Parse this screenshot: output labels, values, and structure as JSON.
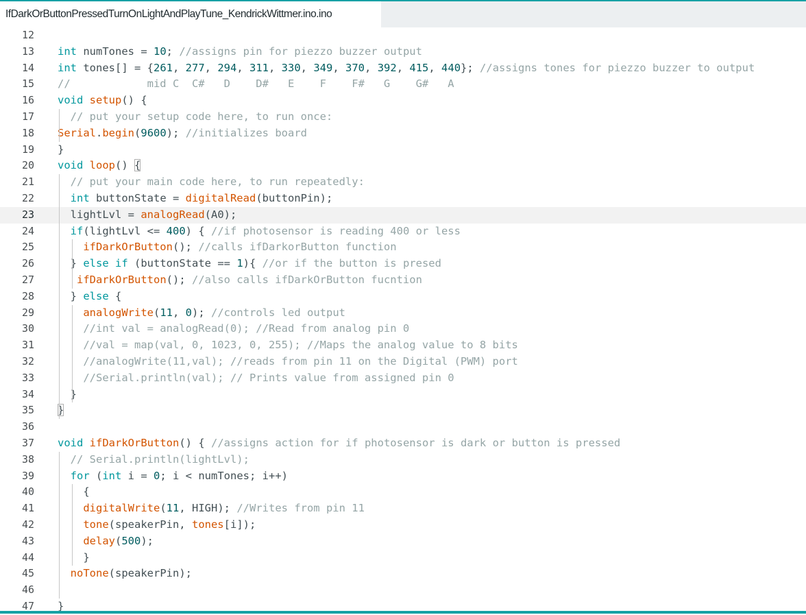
{
  "tab": {
    "filename": "IfDarkOrButtonPressedTurnOnLightAndPlayTune_KendrickWittmer.ino.ino"
  },
  "editor": {
    "current_line": "23",
    "lines": [
      {
        "n": "12",
        "tokens": []
      },
      {
        "n": "13",
        "tokens": [
          {
            "t": "int",
            "c": "kw"
          },
          {
            "t": " numTones = ",
            "c": "tx"
          },
          {
            "t": "10",
            "c": "num"
          },
          {
            "t": "; ",
            "c": "tx"
          },
          {
            "t": "//assigns pin for piezzo buzzer output",
            "c": "cm"
          }
        ]
      },
      {
        "n": "14",
        "tokens": [
          {
            "t": "int",
            "c": "kw"
          },
          {
            "t": " tones[] = {",
            "c": "tx"
          },
          {
            "t": "261",
            "c": "num"
          },
          {
            "t": ", ",
            "c": "tx"
          },
          {
            "t": "277",
            "c": "num"
          },
          {
            "t": ", ",
            "c": "tx"
          },
          {
            "t": "294",
            "c": "num"
          },
          {
            "t": ", ",
            "c": "tx"
          },
          {
            "t": "311",
            "c": "num"
          },
          {
            "t": ", ",
            "c": "tx"
          },
          {
            "t": "330",
            "c": "num"
          },
          {
            "t": ", ",
            "c": "tx"
          },
          {
            "t": "349",
            "c": "num"
          },
          {
            "t": ", ",
            "c": "tx"
          },
          {
            "t": "370",
            "c": "num"
          },
          {
            "t": ", ",
            "c": "tx"
          },
          {
            "t": "392",
            "c": "num"
          },
          {
            "t": ", ",
            "c": "tx"
          },
          {
            "t": "415",
            "c": "num"
          },
          {
            "t": ", ",
            "c": "tx"
          },
          {
            "t": "440",
            "c": "num"
          },
          {
            "t": "}; ",
            "c": "tx"
          },
          {
            "t": "//assigns tones for piezzo buzzer to output",
            "c": "cm"
          }
        ]
      },
      {
        "n": "15",
        "tokens": [
          {
            "t": "//            mid C  C#   D    D#   E    F    F#   G    G#   A",
            "c": "cm"
          }
        ]
      },
      {
        "n": "16",
        "tokens": [
          {
            "t": "void",
            "c": "kw"
          },
          {
            "t": " ",
            "c": "tx"
          },
          {
            "t": "setup",
            "c": "fn"
          },
          {
            "t": "() {",
            "c": "tx"
          }
        ]
      },
      {
        "n": "17",
        "tokens": [
          {
            "t": "  // put your setup code here, to run once:",
            "c": "cm"
          }
        ]
      },
      {
        "n": "18",
        "tokens": [
          {
            "t": "Serial",
            "c": "fn"
          },
          {
            "t": ".",
            "c": "tx"
          },
          {
            "t": "begin",
            "c": "fn"
          },
          {
            "t": "(",
            "c": "tx"
          },
          {
            "t": "9600",
            "c": "num"
          },
          {
            "t": "); ",
            "c": "tx"
          },
          {
            "t": "//initializes board",
            "c": "cm"
          }
        ]
      },
      {
        "n": "19",
        "tokens": [
          {
            "t": "}",
            "c": "tx"
          }
        ]
      },
      {
        "n": "20",
        "tokens": [
          {
            "t": "void",
            "c": "kw"
          },
          {
            "t": " ",
            "c": "tx"
          },
          {
            "t": "loop",
            "c": "fn"
          },
          {
            "t": "() ",
            "c": "tx"
          },
          {
            "t": "{",
            "c": "br"
          }
        ]
      },
      {
        "n": "21",
        "tokens": [
          {
            "t": "  // put your main code here, to run repeatedly:",
            "c": "cm"
          }
        ]
      },
      {
        "n": "22",
        "tokens": [
          {
            "t": "  ",
            "c": "tx"
          },
          {
            "t": "int",
            "c": "kw"
          },
          {
            "t": " buttonState = ",
            "c": "tx"
          },
          {
            "t": "digitalRead",
            "c": "fn"
          },
          {
            "t": "(buttonPin);",
            "c": "tx"
          }
        ]
      },
      {
        "n": "23",
        "tokens": [
          {
            "t": "  lightLvl = ",
            "c": "tx"
          },
          {
            "t": "analogRead",
            "c": "fn"
          },
          {
            "t": "(A0);",
            "c": "tx"
          }
        ]
      },
      {
        "n": "24",
        "tokens": [
          {
            "t": "  ",
            "c": "tx"
          },
          {
            "t": "if",
            "c": "kw"
          },
          {
            "t": "(lightLvl <= ",
            "c": "tx"
          },
          {
            "t": "400",
            "c": "num"
          },
          {
            "t": ") { ",
            "c": "tx"
          },
          {
            "t": "//if photosensor is reading 400 or less",
            "c": "cm"
          }
        ]
      },
      {
        "n": "25",
        "tokens": [
          {
            "t": "    ",
            "c": "tx"
          },
          {
            "t": "ifDarkOrButton",
            "c": "fn"
          },
          {
            "t": "(); ",
            "c": "tx"
          },
          {
            "t": "//calls ifDarkorButton function",
            "c": "cm"
          }
        ]
      },
      {
        "n": "26",
        "tokens": [
          {
            "t": "  } ",
            "c": "tx"
          },
          {
            "t": "else",
            "c": "kw"
          },
          {
            "t": " ",
            "c": "tx"
          },
          {
            "t": "if",
            "c": "kw"
          },
          {
            "t": " (buttonState == ",
            "c": "tx"
          },
          {
            "t": "1",
            "c": "num"
          },
          {
            "t": "){ ",
            "c": "tx"
          },
          {
            "t": "//or if the button is presed",
            "c": "cm"
          }
        ]
      },
      {
        "n": "27",
        "tokens": [
          {
            "t": "   ",
            "c": "tx"
          },
          {
            "t": "ifDarkOrButton",
            "c": "fn"
          },
          {
            "t": "(); ",
            "c": "tx"
          },
          {
            "t": "//also calls ifDarkOrButton fucntion",
            "c": "cm"
          }
        ]
      },
      {
        "n": "28",
        "tokens": [
          {
            "t": "  } ",
            "c": "tx"
          },
          {
            "t": "else",
            "c": "kw"
          },
          {
            "t": " {",
            "c": "tx"
          }
        ]
      },
      {
        "n": "29",
        "tokens": [
          {
            "t": "    ",
            "c": "tx"
          },
          {
            "t": "analogWrite",
            "c": "fn"
          },
          {
            "t": "(",
            "c": "tx"
          },
          {
            "t": "11",
            "c": "num"
          },
          {
            "t": ", ",
            "c": "tx"
          },
          {
            "t": "0",
            "c": "num"
          },
          {
            "t": "); ",
            "c": "tx"
          },
          {
            "t": "//controls led output",
            "c": "cm"
          }
        ]
      },
      {
        "n": "30",
        "tokens": [
          {
            "t": "    //int val = analogRead(0); //Read from analog pin 0",
            "c": "cm"
          }
        ]
      },
      {
        "n": "31",
        "tokens": [
          {
            "t": "    //val = map(val, 0, 1023, 0, 255); //Maps the analog value to 8 bits",
            "c": "cm"
          }
        ]
      },
      {
        "n": "32",
        "tokens": [
          {
            "t": "    //analogWrite(11,val); //reads from pin 11 on the Digital (PWM) port",
            "c": "cm"
          }
        ]
      },
      {
        "n": "33",
        "tokens": [
          {
            "t": "    //Serial.println(val); // Prints value from assigned pin 0",
            "c": "cm"
          }
        ]
      },
      {
        "n": "34",
        "tokens": [
          {
            "t": "  }",
            "c": "tx"
          }
        ]
      },
      {
        "n": "35",
        "tokens": [
          {
            "t": "}",
            "c": "br"
          }
        ]
      },
      {
        "n": "36",
        "tokens": []
      },
      {
        "n": "37",
        "tokens": [
          {
            "t": "void",
            "c": "kw"
          },
          {
            "t": " ",
            "c": "tx"
          },
          {
            "t": "ifDarkOrButton",
            "c": "fn"
          },
          {
            "t": "() { ",
            "c": "tx"
          },
          {
            "t": "//assigns action for if photosensor is dark or button is pressed",
            "c": "cm"
          }
        ]
      },
      {
        "n": "38",
        "tokens": [
          {
            "t": "  // Serial.println(lightLvl);",
            "c": "cm"
          }
        ]
      },
      {
        "n": "39",
        "tokens": [
          {
            "t": "  ",
            "c": "tx"
          },
          {
            "t": "for",
            "c": "kw"
          },
          {
            "t": " (",
            "c": "tx"
          },
          {
            "t": "int",
            "c": "kw"
          },
          {
            "t": " i = ",
            "c": "tx"
          },
          {
            "t": "0",
            "c": "num"
          },
          {
            "t": "; i < numTones; i++)",
            "c": "tx"
          }
        ]
      },
      {
        "n": "40",
        "tokens": [
          {
            "t": "    {",
            "c": "tx"
          }
        ]
      },
      {
        "n": "41",
        "tokens": [
          {
            "t": "    ",
            "c": "tx"
          },
          {
            "t": "digitalWrite",
            "c": "fn"
          },
          {
            "t": "(",
            "c": "tx"
          },
          {
            "t": "11",
            "c": "num"
          },
          {
            "t": ", HIGH); ",
            "c": "tx"
          },
          {
            "t": "//Writes from pin 11",
            "c": "cm"
          }
        ]
      },
      {
        "n": "42",
        "tokens": [
          {
            "t": "    ",
            "c": "tx"
          },
          {
            "t": "tone",
            "c": "fn"
          },
          {
            "t": "(speakerPin, ",
            "c": "tx"
          },
          {
            "t": "tones",
            "c": "fn"
          },
          {
            "t": "[i]);",
            "c": "tx"
          }
        ]
      },
      {
        "n": "43",
        "tokens": [
          {
            "t": "    ",
            "c": "tx"
          },
          {
            "t": "delay",
            "c": "fn"
          },
          {
            "t": "(",
            "c": "tx"
          },
          {
            "t": "500",
            "c": "num"
          },
          {
            "t": ");",
            "c": "tx"
          }
        ]
      },
      {
        "n": "44",
        "tokens": [
          {
            "t": "    }",
            "c": "tx"
          }
        ]
      },
      {
        "n": "45",
        "tokens": [
          {
            "t": "  ",
            "c": "tx"
          },
          {
            "t": "noTone",
            "c": "fn"
          },
          {
            "t": "(speakerPin);",
            "c": "tx"
          }
        ]
      },
      {
        "n": "46",
        "tokens": []
      },
      {
        "n": "47",
        "tokens": [
          {
            "t": "}",
            "c": "tx"
          }
        ]
      }
    ]
  },
  "colors": {
    "accent": "#17a1a5",
    "keyword": "#00979d",
    "function": "#d35400",
    "comment": "#95a5a6",
    "number": "#005c5f",
    "text": "#434f54"
  }
}
